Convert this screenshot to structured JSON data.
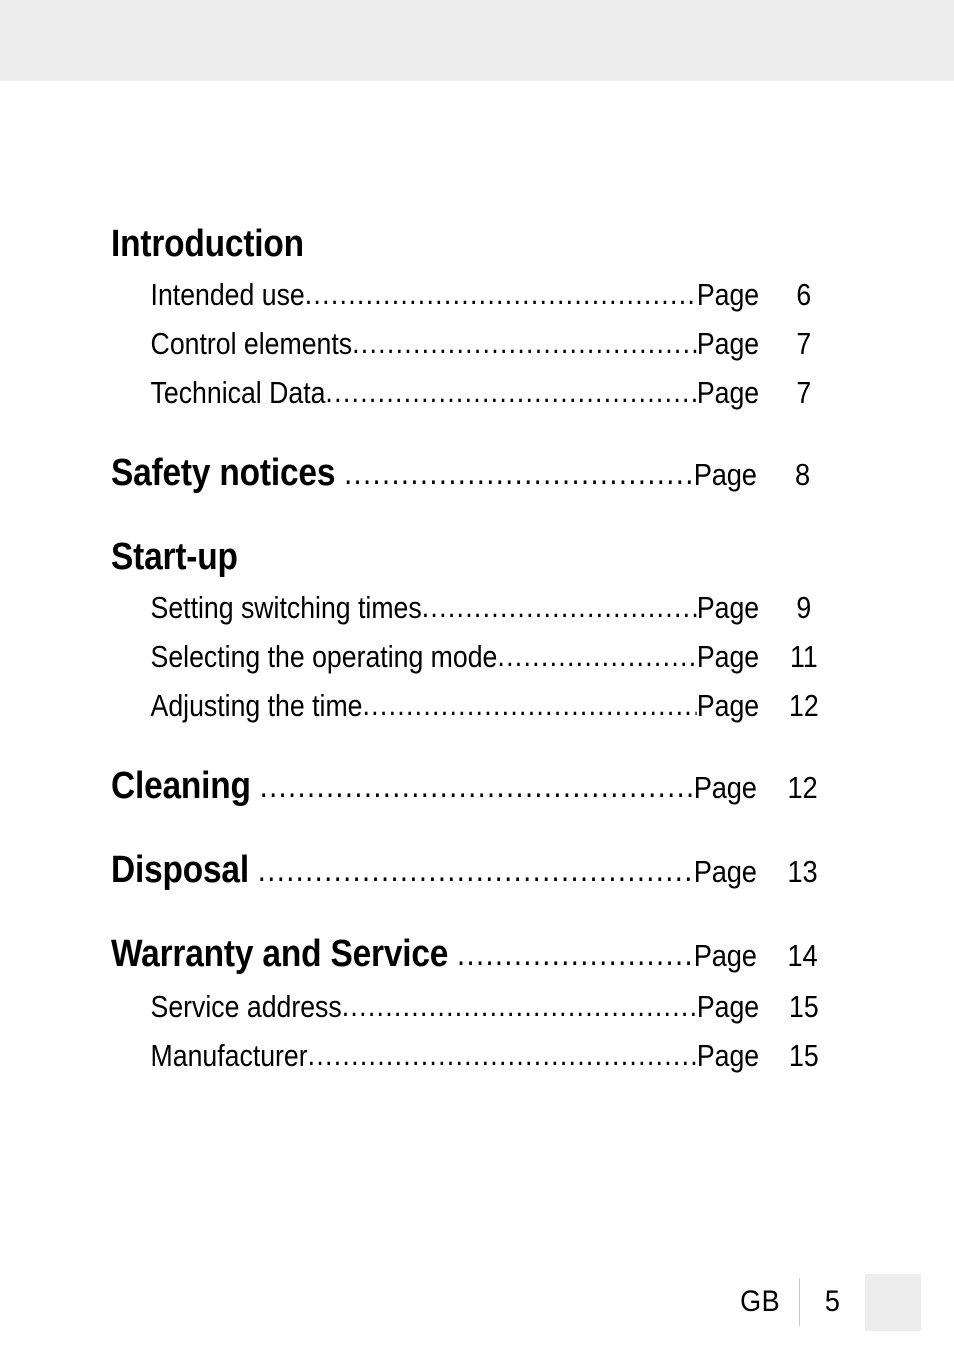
{
  "document": {
    "page_label": "5",
    "language_code": "GB",
    "page_word": "Page"
  },
  "theme": {
    "band_color": "#ededed",
    "text_color": "#000000",
    "divider_color": "#c9c9c9"
  },
  "toc": {
    "groups": [
      {
        "heading": {
          "label": "Introduction",
          "page_word": "",
          "page": ""
        },
        "entries": [
          {
            "label": "Intended use",
            "page_word": "Page",
            "page": "6"
          },
          {
            "label": "Control elements",
            "page_word": "Page",
            "page": "7"
          },
          {
            "label": "Technical Data",
            "page_word": "Page",
            "page": "7"
          }
        ]
      },
      {
        "heading": {
          "label": "Safety notices",
          "page_word": "Page",
          "page": "8"
        },
        "entries": []
      },
      {
        "heading": {
          "label": "Start-up",
          "page_word": "",
          "page": ""
        },
        "entries": [
          {
            "label": "Setting switching times",
            "page_word": "Page",
            "page": "9"
          },
          {
            "label": "Selecting the operating mode",
            "page_word": "Page",
            "page": "11"
          },
          {
            "label": "Adjusting the time",
            "page_word": "Page",
            "page": "12"
          }
        ]
      },
      {
        "heading": {
          "label": "Cleaning",
          "page_word": "Page",
          "page": "12"
        },
        "entries": []
      },
      {
        "heading": {
          "label": "Disposal",
          "page_word": "Page",
          "page": "13"
        },
        "entries": []
      },
      {
        "heading": {
          "label": "Warranty and Service",
          "page_word": "Page",
          "page": "14"
        },
        "entries": [
          {
            "label": "Service address",
            "page_word": "Page",
            "page": "15"
          },
          {
            "label": "Manufacturer",
            "page_word": "Page",
            "page": "15"
          }
        ]
      }
    ]
  }
}
